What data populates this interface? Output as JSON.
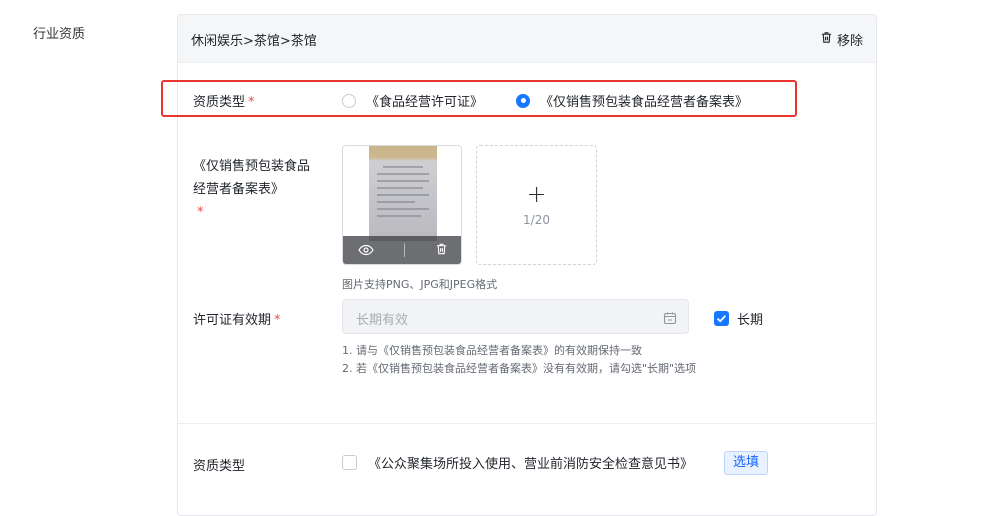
{
  "section": {
    "label": "行业资质"
  },
  "card": {
    "breadcrumb": "休闲娱乐>茶馆>茶馆",
    "remove_label": "移除"
  },
  "qualification_type": {
    "label": "资质类型",
    "required_mark": "*",
    "options": [
      {
        "label": "《食品经营许可证》",
        "checked": false
      },
      {
        "label": "《仅销售预包装食品经营者备案表》",
        "checked": true
      }
    ]
  },
  "upload": {
    "label_line1": "《仅销售预包装食品",
    "label_line2": "经营者备案表》",
    "required_mark": "*",
    "plus": "+",
    "count": "1/20",
    "format_hint": "图片支持PNG、JPG和JPEG格式"
  },
  "validity": {
    "label": "许可证有效期",
    "required_mark": "*",
    "placeholder": "长期有效",
    "long_term_label": "长期",
    "long_term_checked": true,
    "hint1": "1. 请与《仅销售预包装食品经营者备案表》的有效期保持一致",
    "hint2": "2. 若《仅销售预包装食品经营者备案表》没有有效期，请勾选\"长期\"选项"
  },
  "optional_qualification": {
    "label": "资质类型",
    "checkbox_label": "《公众聚集场所投入使用、营业前消防安全检查意见书》",
    "tag": "选填"
  },
  "colors": {
    "primary": "#1677ff",
    "required": "#f54a45",
    "highlight_box": "#e8362f"
  },
  "icons": {
    "remove": "trash-icon",
    "preview": "eye-icon",
    "delete": "trash-icon",
    "calendar": "calendar-icon",
    "check": "checkmark-icon"
  }
}
